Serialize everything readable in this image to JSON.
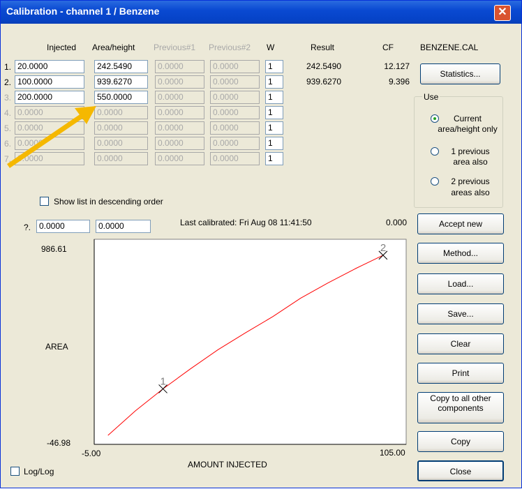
{
  "window": {
    "title": "Calibration - channel 1 / Benzene",
    "close_glyph": "✕"
  },
  "headers": {
    "injected": "Injected",
    "area_height": "Area/height",
    "previous1": "Previous#1",
    "previous2": "Previous#2",
    "w": "W",
    "result": "Result",
    "cf": "CF",
    "file": "BENZENE.CAL"
  },
  "rows": [
    {
      "num": "1.",
      "injected": "20.0000",
      "area": "242.5490",
      "prev1": "0.0000",
      "prev2": "0.0000",
      "w": "1",
      "result": "242.5490",
      "cf": "12.127"
    },
    {
      "num": "2.",
      "injected": "100.0000",
      "area": "939.6270",
      "prev1": "0.0000",
      "prev2": "0.0000",
      "w": "1",
      "result": "939.6270",
      "cf": "9.396"
    },
    {
      "num": "3.",
      "injected": "200.0000",
      "area": "550.0000",
      "prev1": "0.0000",
      "prev2": "0.0000",
      "w": "1",
      "result": "",
      "cf": ""
    },
    {
      "num": "4.",
      "injected": "0.0000",
      "area": "0.0000",
      "prev1": "0.0000",
      "prev2": "0.0000",
      "w": "1",
      "result": "",
      "cf": ""
    },
    {
      "num": "5.",
      "injected": "0.0000",
      "area": "0.0000",
      "prev1": "0.0000",
      "prev2": "0.0000",
      "w": "1",
      "result": "",
      "cf": ""
    },
    {
      "num": "6.",
      "injected": "0.0000",
      "area": "0.0000",
      "prev1": "0.0000",
      "prev2": "0.0000",
      "w": "1",
      "result": "",
      "cf": ""
    },
    {
      "num": "7.",
      "injected": "0.0000",
      "area": "0.0000",
      "prev1": "0.0000",
      "prev2": "0.0000",
      "w": "1",
      "result": "",
      "cf": ""
    }
  ],
  "show_descending_label": "Show list in descending order",
  "unknown_row": {
    "num": "?.",
    "injected": "0.0000",
    "area": "0.0000"
  },
  "last_calibrated": "Last calibrated:  Fri Aug 08 11:41:50",
  "unknown_result": "0.000",
  "use_group": {
    "title": "Use",
    "options": [
      {
        "line1": "Current",
        "line2": "area/height only",
        "selected": true
      },
      {
        "line1": "1 previous",
        "line2": "area also",
        "selected": false
      },
      {
        "line1": "2 previous",
        "line2": "areas also",
        "selected": false
      }
    ]
  },
  "buttons": {
    "statistics": "Statistics...",
    "accept_new": "Accept new",
    "method": "Method...",
    "load": "Load...",
    "save": "Save...",
    "clear": "Clear",
    "print": "Print",
    "copy_all_1": "Copy to all other",
    "copy_all_2": "components",
    "copy": "Copy",
    "close": "Close"
  },
  "loglog_label": "Log/Log",
  "accent_color": "#f5b800",
  "chart_data": {
    "type": "line",
    "ylabel": "AREA",
    "xlabel": "AMOUNT INJECTED",
    "xlim": [
      -5.0,
      105.0
    ],
    "ylim": [
      -46.98,
      986.61
    ],
    "xlim_labels": [
      "-5.00",
      "105.00"
    ],
    "ylim_labels": [
      "986.61",
      "-46.98"
    ],
    "points": [
      {
        "label": "1",
        "x": 20.0,
        "y": 242.549
      },
      {
        "label": "2",
        "x": 100.0,
        "y": 939.627
      }
    ],
    "curve": {
      "x": [
        0,
        10,
        20,
        30,
        40,
        50,
        60,
        70,
        80,
        90,
        100
      ],
      "y": [
        0,
        128,
        242.5,
        347,
        447,
        535,
        620,
        715,
        795,
        870,
        939.6
      ]
    },
    "curve_color": "#ff0000"
  }
}
